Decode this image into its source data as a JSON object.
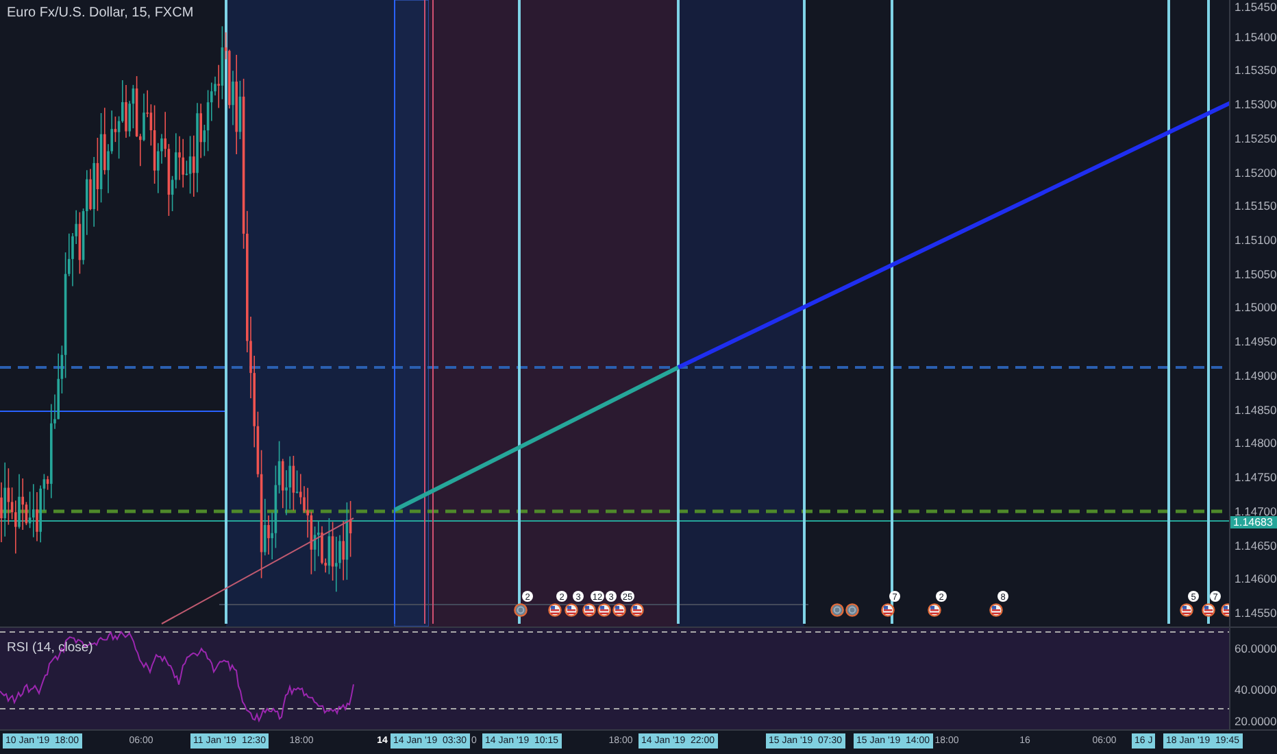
{
  "chart": {
    "title": "Euro Fx/U.S. Dollar, 15, FXCM"
  },
  "price_axis": {
    "labels": [
      "1.15450",
      "1.15400",
      "1.15350",
      "1.15300",
      "1.15250",
      "1.15200",
      "1.15150",
      "1.15100",
      "1.15050",
      "1.15000",
      "1.14950",
      "1.14900",
      "1.14850",
      "1.14800",
      "1.14750",
      "1.14700",
      "1.14650",
      "1.14600",
      "1.14550"
    ],
    "current_price": "1.14683"
  },
  "events": [
    {
      "kind": "globe",
      "badge": "2"
    },
    {
      "kind": "us-flag",
      "badge": "2"
    },
    {
      "kind": "us-flag",
      "badge": "3"
    },
    {
      "kind": "us-flag",
      "badge": "12"
    },
    {
      "kind": "us-flag",
      "badge": "3"
    },
    {
      "kind": "us-flag",
      "badge": "25"
    },
    {
      "kind": "us-flag"
    },
    {
      "kind": "globe"
    },
    {
      "kind": "globe"
    },
    {
      "kind": "us-flag",
      "badge": "7"
    },
    {
      "kind": "us-flag",
      "badge": "2"
    },
    {
      "kind": "us-flag",
      "badge": "8"
    },
    {
      "kind": "us-flag",
      "badge": "5"
    },
    {
      "kind": "us-flag",
      "badge": "7"
    },
    {
      "kind": "us-flag"
    }
  ],
  "rsi": {
    "title": "RSI (14, close)",
    "axis_labels": [
      "60.0000",
      "40.0000",
      "20.0000"
    ]
  },
  "time_axis": {
    "labels": [
      {
        "text": "10 Jan '19  18:00",
        "kind": "marker"
      },
      {
        "text": "06:00",
        "kind": "time"
      },
      {
        "text": "11 Jan '19  12:30",
        "kind": "marker"
      },
      {
        "text": "18:00",
        "kind": "time"
      },
      {
        "text": "14",
        "kind": "day"
      },
      {
        "text": "14 Jan '19  03:30",
        "kind": "marker"
      },
      {
        "text": "0",
        "kind": "time"
      },
      {
        "text": "14 Jan '19  10:15",
        "kind": "marker"
      },
      {
        "text": "18:00",
        "kind": "time"
      },
      {
        "text": "14 Jan '19  22:00",
        "kind": "marker"
      },
      {
        "text": "15 Jan '19  07:30",
        "kind": "marker"
      },
      {
        "text": "15 Jan '19  14:00",
        "kind": "marker"
      },
      {
        "text": "18:00",
        "kind": "time"
      },
      {
        "text": "16",
        "kind": "time"
      },
      {
        "text": "06:00",
        "kind": "time"
      },
      {
        "text": "16 J",
        "kind": "marker"
      },
      {
        "text": "18 Jan '19  19:45",
        "kind": "marker"
      }
    ]
  }
}
